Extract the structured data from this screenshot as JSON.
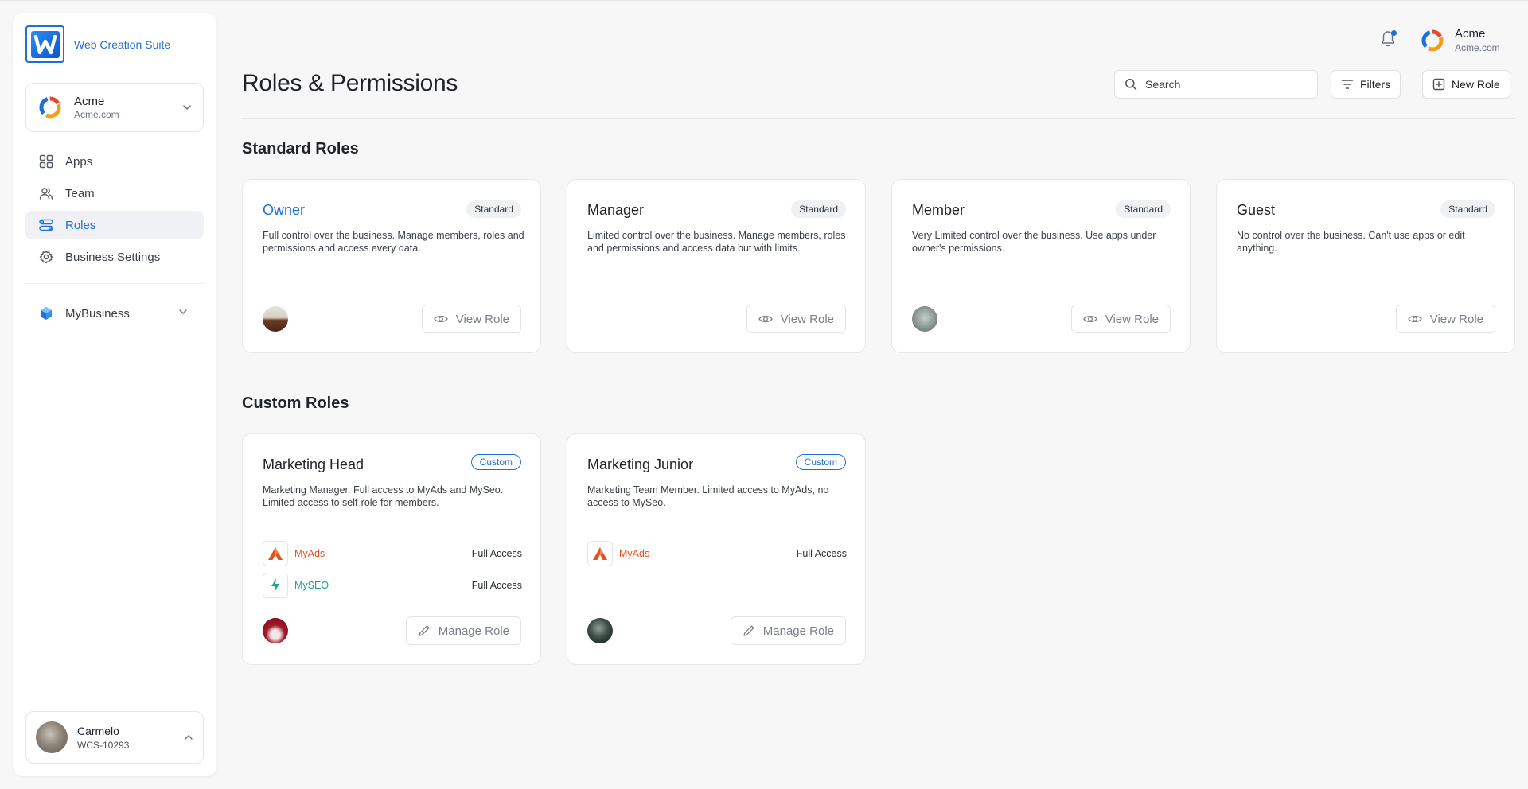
{
  "brand": {
    "name": "Web Creation Suite",
    "logo_letter": "W"
  },
  "org": {
    "name": "Acme",
    "domain": "Acme.com"
  },
  "sidebar": {
    "items": [
      {
        "label": "Apps",
        "icon": "apps-grid-icon"
      },
      {
        "label": "Team",
        "icon": "team-icon"
      },
      {
        "label": "Roles",
        "icon": "roles-icon",
        "active": true
      },
      {
        "label": "Business Settings",
        "icon": "gear-icon"
      }
    ],
    "mybusiness": {
      "label": "MyBusiness",
      "icon": "cube-icon"
    }
  },
  "user": {
    "name": "Carmelo",
    "id": "WCS-10293"
  },
  "header": {
    "account_name": "Acme",
    "account_domain": "Acme.com",
    "search_placeholder": "Search",
    "filters_label": "Filters",
    "new_role_label": "New Role"
  },
  "page": {
    "title": "Roles & Permissions"
  },
  "standard_section": {
    "title": "Standard Roles",
    "roles": [
      {
        "title": "Owner",
        "badge": "Standard",
        "description": "Full control over the business. Manage members, roles and permissions and access every data.",
        "button": "View Role",
        "has_avatar": true
      },
      {
        "title": "Manager",
        "badge": "Standard",
        "description": "Limited control over the business. Manage members, roles and permissions and access data but with limits.",
        "button": "View Role",
        "has_avatar": false
      },
      {
        "title": "Member",
        "badge": "Standard",
        "description": "Very Limited control over the business. Use apps under owner's permissions.",
        "button": "View Role",
        "has_avatar": true
      },
      {
        "title": "Guest",
        "badge": "Standard",
        "description": "No control over the business. Can't use apps or edit anything.",
        "button": "View Role",
        "has_avatar": false
      }
    ]
  },
  "custom_section": {
    "title": "Custom Roles",
    "roles": [
      {
        "title": "Marketing Head",
        "badge": "Custom",
        "description": "Marketing Manager. Full access to MyAds and MySeo. Limited access to self-role for members.",
        "apps": [
          {
            "name": "MyAds",
            "access": "Full Access",
            "color": "#e0531f"
          },
          {
            "name": "MySEO",
            "access": "Full Access",
            "color": "#19a58e"
          }
        ],
        "button": "Manage Role"
      },
      {
        "title": "Marketing Junior",
        "badge": "Custom",
        "description": "Marketing Team Member. Limited access to MyAds, no access to MySeo.",
        "apps": [
          {
            "name": "MyAds",
            "access": "Full Access",
            "color": "#e0531f"
          }
        ],
        "button": "Manage Role"
      }
    ]
  },
  "colors": {
    "accent": "#1f6fd8",
    "myads": "#e0531f",
    "myseo": "#19a58e"
  }
}
